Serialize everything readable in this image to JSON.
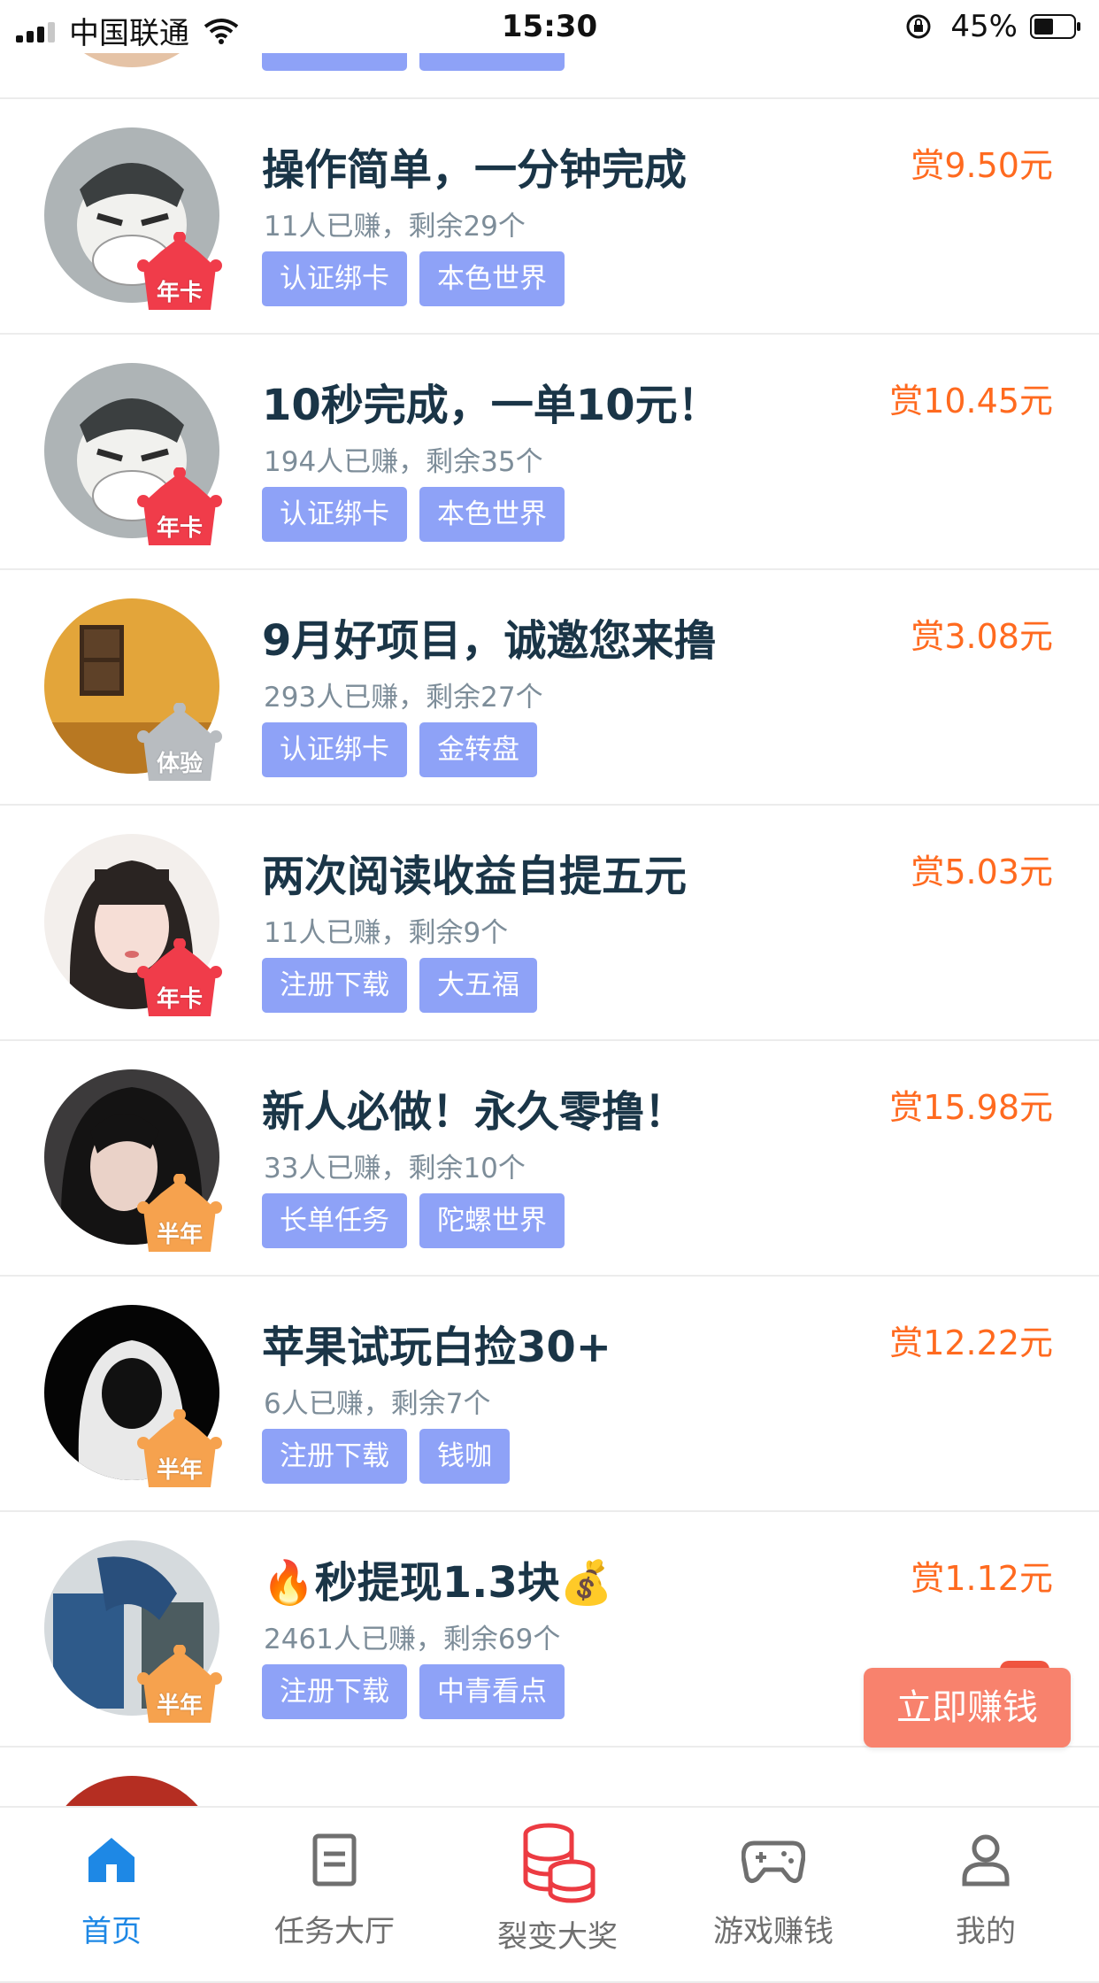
{
  "status_bar": {
    "carrier": "中国联通",
    "time": "15:30",
    "battery": "45%"
  },
  "colors": {
    "accent": "#1e88e5",
    "tag_bg": "#8ea2f7",
    "reward": "#ff6a1f",
    "earn_button": "#f8826d"
  },
  "tasks": [
    {
      "title": "操作简单，一分钟完成",
      "stats": "11人已赚，剩余29个",
      "reward": "赏9.50元",
      "tags": [
        "认证绑卡",
        "本色世界"
      ],
      "badge": "年卡"
    },
    {
      "title": "10秒完成，一单10元！",
      "stats": "194人已赚，剩余35个",
      "reward": "赏10.45元",
      "tags": [
        "认证绑卡",
        "本色世界"
      ],
      "badge": "年卡"
    },
    {
      "title": "9月好项目，诚邀您来撸",
      "stats": "293人已赚，剩余27个",
      "reward": "赏3.08元",
      "tags": [
        "认证绑卡",
        "金转盘"
      ],
      "badge": "体验"
    },
    {
      "title": "两次阅读收益自提五元",
      "stats": "11人已赚，剩余9个",
      "reward": "赏5.03元",
      "tags": [
        "注册下载",
        "大五福"
      ],
      "badge": "年卡"
    },
    {
      "title": "新人必做！永久零撸！",
      "stats": "33人已赚，剩余10个",
      "reward": "赏15.98元",
      "tags": [
        "长单任务",
        "陀螺世界"
      ],
      "badge": "半年"
    },
    {
      "title": "苹果试玩白捡30+",
      "stats": "6人已赚，剩余7个",
      "reward": "赏12.22元",
      "tags": [
        "注册下载",
        "钱咖"
      ],
      "badge": "半年"
    },
    {
      "title": "🔥秒提现1.3块💰",
      "stats": "2461人已赚，剩余69个",
      "reward": "赏1.12元",
      "tags": [
        "注册下载",
        "中青看点"
      ],
      "badge": "半年"
    }
  ],
  "earn_button": "立即赚钱",
  "bottom_nav": [
    {
      "label": "首页",
      "icon": "home-icon",
      "active": true
    },
    {
      "label": "任务大厅",
      "icon": "document-icon",
      "active": false
    },
    {
      "label": "裂变大奖",
      "icon": "coin-stack-icon",
      "active": false
    },
    {
      "label": "游戏赚钱",
      "icon": "gamepad-icon",
      "active": false
    },
    {
      "label": "我的",
      "icon": "user-icon",
      "active": false
    }
  ]
}
